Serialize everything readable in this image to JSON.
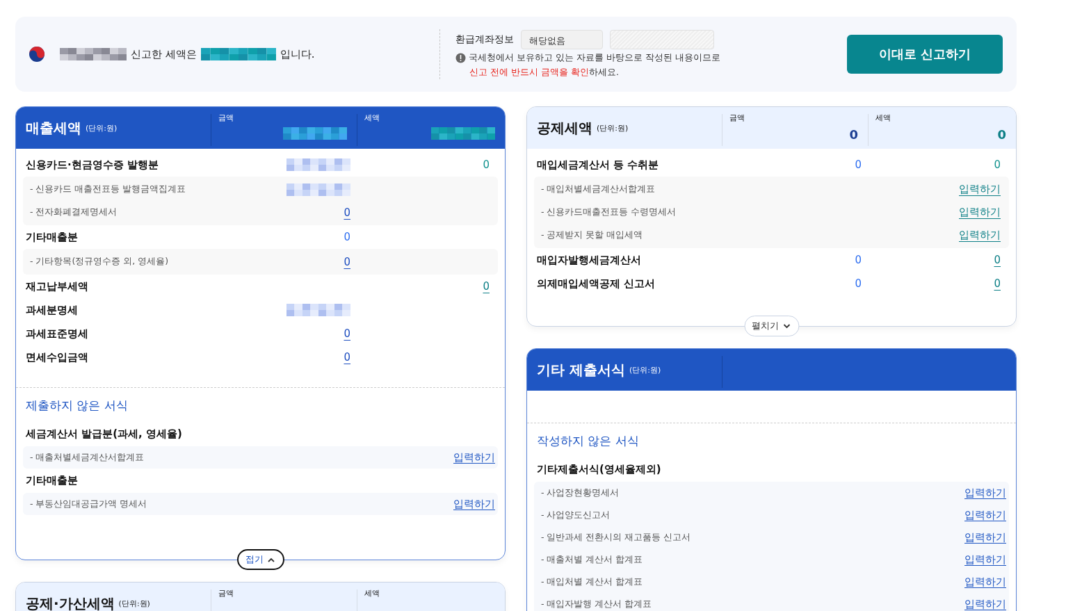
{
  "banner": {
    "name_redacted": true,
    "before": "신고한 세액은",
    "amount_redacted": true,
    "after": "입니다.",
    "refund": {
      "label": "환급계좌정보",
      "fields": [
        {
          "value": "해당없음",
          "disabled": false
        },
        {
          "disabled": true
        }
      ],
      "note": "국세청에서 보유하고 있는 자료를 바탕으로 작성된 내용이므로",
      "warning": {
        "emphasis": "신고 전에 반드시 금액을 확인",
        "rest": "하세요."
      }
    },
    "button": "이대로 신고하기"
  },
  "columns": [
    {
      "panels": [
        {
          "title": "매출세액",
          "unit": "(단위:원)",
          "highlighted": true,
          "header": [
            {
              "label": "금액",
              "value": {
                "redacted": true
              }
            },
            {
              "label": "세액",
              "value": {
                "redacted": true
              }
            }
          ],
          "rows": [
            {
              "kind": "main",
              "label": "신용카드·현금영수증 발행분",
              "amount": {
                "redacted": true
              },
              "tax": {
                "text": "0",
                "link": false
              }
            },
            {
              "kind": "group",
              "items": [
                {
                  "label": "- 신용카드 매출전표등 발행금액집계표",
                  "amount": {
                    "redacted": true
                  }
                },
                {
                  "label": "- 전자화폐결제명세서",
                  "amount": {
                    "text": "0",
                    "link": true
                  }
                }
              ]
            },
            {
              "kind": "main",
              "label": "기타매출분",
              "amount": {
                "text": "0",
                "link": false
              }
            },
            {
              "kind": "group",
              "items": [
                {
                  "label": "- 기타항목(정규영수증 외, 영세율)",
                  "amount": {
                    "text": "0",
                    "link": true
                  }
                }
              ]
            },
            {
              "kind": "main",
              "label": "재고납부세액",
              "tax": {
                "text": "0",
                "link": true
              }
            },
            {
              "kind": "main",
              "label": "과세분명세",
              "amount": {
                "redacted": true
              }
            },
            {
              "kind": "main",
              "label": "과세표준명세",
              "amount": {
                "text": "0",
                "link": true
              }
            },
            {
              "kind": "main",
              "label": "면세수입금액",
              "amount": {
                "text": "0",
                "link": true
              }
            }
          ],
          "forms": {
            "title": "제출하지 않은 서식",
            "sections": [
              {
                "title": "세금계산서 발급분(과세, 영세율)",
                "items": [
                  {
                    "label": "- 매출처별세금계산서합계표",
                    "action": "입력하기"
                  }
                ]
              },
              {
                "title": "기타매출분",
                "items": [
                  {
                    "label": "- 부동산임대공급가액 명세서",
                    "action": "입력하기"
                  }
                ]
              }
            ]
          },
          "toggle": {
            "label": "접기",
            "expanded": true
          }
        },
        {
          "title": "공제·가산세액",
          "unit": "(단위:원)",
          "highlighted": false,
          "header": [
            {
              "label": "금액"
            },
            {
              "label": "세액"
            }
          ]
        }
      ]
    },
    {
      "panels": [
        {
          "title": "공제세액",
          "unit": "(단위:원)",
          "highlighted": false,
          "header": [
            {
              "label": "금액",
              "value": {
                "text": "0",
                "link": false
              }
            },
            {
              "label": "세액",
              "value": {
                "text": "0",
                "link": false
              }
            }
          ],
          "rows": [
            {
              "kind": "main",
              "label": "매입세금계산서 등 수취분",
              "amount": {
                "text": "0",
                "link": false
              },
              "tax": {
                "text": "0",
                "link": false
              }
            },
            {
              "kind": "group",
              "items": [
                {
                  "label": "- 매입처별세금계산서합계표",
                  "tax": {
                    "text": "입력하기",
                    "link": true
                  }
                },
                {
                  "label": "- 신용카드매출전표등 수령명세서",
                  "tax": {
                    "text": "입력하기",
                    "link": true
                  }
                },
                {
                  "label": "- 공제받지 못할 매입세액",
                  "tax": {
                    "text": "입력하기",
                    "link": true
                  }
                }
              ]
            },
            {
              "kind": "main",
              "label": "매입자발행세금계산서",
              "amount": {
                "text": "0",
                "link": false
              },
              "tax": {
                "text": "0",
                "link": true
              }
            },
            {
              "kind": "main",
              "label": "의제매입세액공제 신고서",
              "amount": {
                "text": "0",
                "link": false
              },
              "tax": {
                "text": "0",
                "link": true
              }
            }
          ],
          "toggle": {
            "label": "펼치기",
            "expanded": false
          }
        },
        {
          "title": "기타 제출서식",
          "unit": "(단위:원)",
          "highlighted": true,
          "forms": {
            "title": "작성하지 않은 서식",
            "sections": [
              {
                "title": "기타제출서식(영세율제외)",
                "items": [
                  {
                    "label": "- 사업장현황명세서",
                    "action": "입력하기"
                  },
                  {
                    "label": "- 사업양도신고서",
                    "action": "입력하기"
                  },
                  {
                    "label": "- 일반과세 전환시의 재고품등 신고서",
                    "action": "입력하기"
                  },
                  {
                    "label": "- 매출처별 계산서 합계표",
                    "action": "입력하기"
                  },
                  {
                    "label": "- 매입처별 계산서 합계표",
                    "action": "입력하기"
                  },
                  {
                    "label": "- 매입자발행 계산서 합계표",
                    "action": "입력하기"
                  }
                ]
              }
            ]
          }
        }
      ]
    }
  ]
}
